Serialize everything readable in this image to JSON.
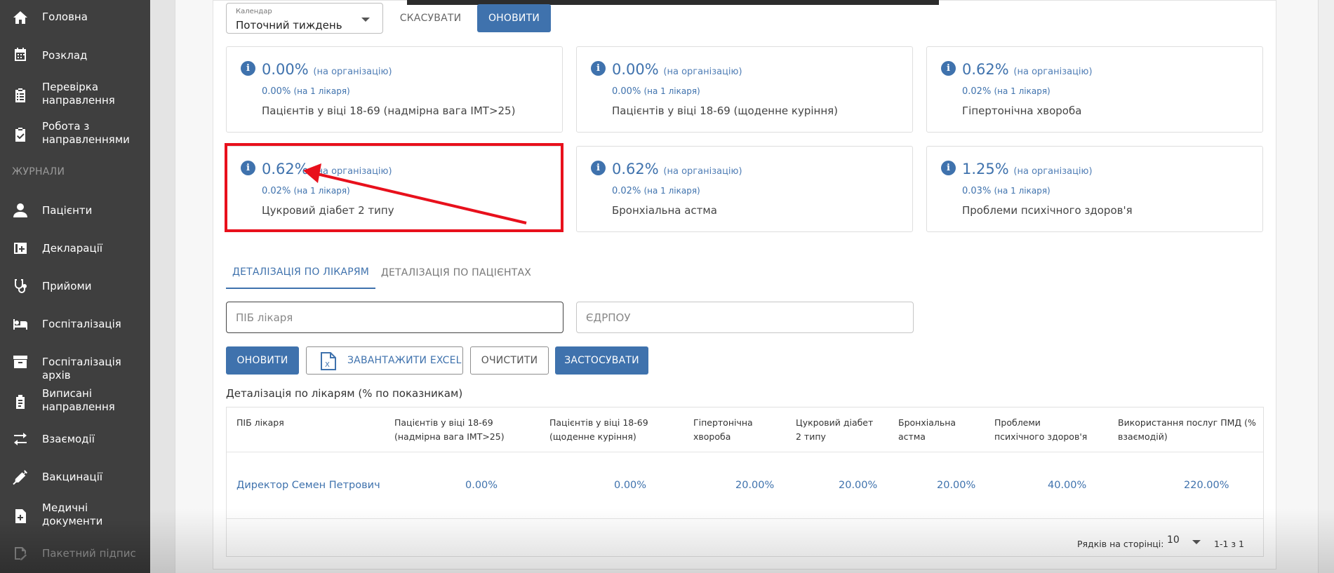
{
  "sidebar": {
    "items": [
      {
        "label": "Головна",
        "icon": "home-icon"
      },
      {
        "label": "Розклад",
        "icon": "calendar-icon"
      },
      {
        "label": "Перевірка\nнаправлення",
        "icon": "clipboard-list-icon"
      },
      {
        "label": "Робота з\nнаправленнями",
        "icon": "clipboard-check-icon"
      },
      {
        "label": "Пацієнти",
        "icon": "user-icon"
      },
      {
        "label": "Декларації",
        "icon": "medical-file-icon"
      },
      {
        "label": "Прийоми",
        "icon": "stethoscope-icon"
      },
      {
        "label": "Госпіталізація",
        "icon": "bed-icon"
      },
      {
        "label": "Госпіталізація архів",
        "icon": "archive-icon"
      },
      {
        "label": "Виписані\nнаправлення",
        "icon": "prescription-icon"
      },
      {
        "label": "Взаємодії",
        "icon": "exchange-icon"
      },
      {
        "label": "Вакцинації",
        "icon": "syringe-icon"
      },
      {
        "label": "Медичні\nдокументи",
        "icon": "medical-document-icon"
      },
      {
        "label": "Пакетний підпис",
        "icon": "signature-icon"
      }
    ],
    "section_journals": "ЖУРНАЛИ"
  },
  "toolbar": {
    "calendar_label": "Календар",
    "calendar_value": "Поточний тиждень",
    "cancel_label": "СКАСУВАТИ",
    "refresh_label": "ОНОВИТИ"
  },
  "cards": [
    {
      "pct": "0.00%",
      "org_note": "(на організацію)",
      "per_doctor": "0.00%",
      "doctor_note": "(на 1 лікаря)",
      "desc": "Пацієнтів у віці 18-69 (надмірна вага ІМТ>25)"
    },
    {
      "pct": "0.00%",
      "org_note": "(на організацію)",
      "per_doctor": "0.00%",
      "doctor_note": "(на 1 лікаря)",
      "desc": "Пацієнтів у віці 18-69 (щоденне куріння)"
    },
    {
      "pct": "0.62%",
      "org_note": "(на організацію)",
      "per_doctor": "0.02%",
      "doctor_note": "(на 1 лікаря)",
      "desc": "Гіпертонічна хвороба"
    },
    {
      "pct": "0.62%",
      "org_note": "(на організацію)",
      "per_doctor": "0.02%",
      "doctor_note": "(на 1 лікаря)",
      "desc": "Цукровий діабет 2 типу"
    },
    {
      "pct": "0.62%",
      "org_note": "(на організацію)",
      "per_doctor": "0.02%",
      "doctor_note": "(на 1 лікаря)",
      "desc": "Бронхіальна астма"
    },
    {
      "pct": "1.25%",
      "org_note": "(на організацію)",
      "per_doctor": "0.03%",
      "doctor_note": "(на 1 лікаря)",
      "desc": "Проблеми психічного здоров'я"
    }
  ],
  "tabs": [
    {
      "label": "ДЕТАЛІЗАЦІЯ ПО ЛІКАРЯМ",
      "active": true
    },
    {
      "label": "ДЕТАЛІЗАЦІЯ ПО ПАЦІЄНТАХ",
      "active": false
    }
  ],
  "filters": {
    "doctor_placeholder": "ПІБ лікаря",
    "edrpou_placeholder": "ЄДРПОУ"
  },
  "actions": {
    "refresh": "ОНОВИТИ",
    "excel": "ЗАВАНТАЖИТИ EXCEL",
    "clear": "ОЧИСТИТИ",
    "apply": "ЗАСТОСУВАТИ"
  },
  "table": {
    "title": "Деталізація по лікарям (% по показникам)",
    "headers": [
      "ПІБ лікаря",
      "Пацієнтів у віці 18-69 (надмірна вага ІМТ>25)",
      "Пацієнтів у віці 18-69 (щоденне куріння)",
      "Гіпертонічна хвороба",
      "Цукровий діабет 2 типу",
      "Бронхіальна астма",
      "Проблеми психічного здоров'я",
      "Використання послуг ПМД (% взаємодій)"
    ],
    "rows": [
      [
        "Директор Семен Петрович",
        "0.00%",
        "0.00%",
        "20.00%",
        "20.00%",
        "20.00%",
        "40.00%",
        "220.00%"
      ]
    ],
    "rows_per_page_label": "Рядків на сторінці:",
    "rows_per_page": "10",
    "range": "1-1 з 1"
  },
  "colors": {
    "primary": "#3f72ad",
    "sidebar": "#3f3f3f",
    "highlight": "#e8101c"
  }
}
